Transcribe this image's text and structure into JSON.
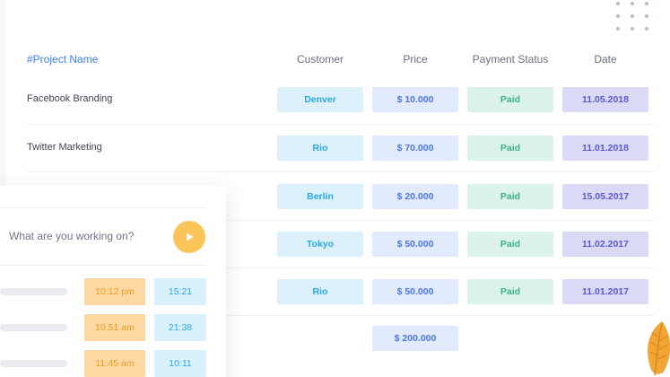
{
  "table": {
    "headers": {
      "project": "#Project Name",
      "customer": "Customer",
      "price": "Price",
      "payment_status": "Payment Status",
      "date": "Date"
    },
    "rows": [
      {
        "project": "Facebook Branding",
        "customer": "Denver",
        "price": "$ 10.000",
        "status": "Paid",
        "date": "11.05.2018"
      },
      {
        "project": "Twitter Marketing",
        "customer": "Rio",
        "price": "$ 70.000",
        "status": "Paid",
        "date": "11.01.2018"
      },
      {
        "project": "",
        "customer": "Berlin",
        "price": "$ 20.000",
        "status": "Paid",
        "date": "15.05.2017"
      },
      {
        "project": "",
        "customer": "Tokyo",
        "price": "$ 50.000",
        "status": "Paid",
        "date": "11.02.2017"
      },
      {
        "project": "",
        "customer": "Rio",
        "price": "$ 50.000",
        "status": "Paid",
        "date": "11.01.2017"
      }
    ],
    "total_price": "$ 200.000"
  },
  "timer": {
    "placeholder": "What are you working on?",
    "entries": [
      {
        "start": "10:12 pm",
        "duration": "15:21"
      },
      {
        "start": "10.51 am",
        "duration": "21:38"
      },
      {
        "start": "11:45 am",
        "duration": "10:11"
      }
    ]
  },
  "colors": {
    "accent_blue": "#3b7ff5",
    "customer_bg": "#ddf1fc",
    "price_bg": "#e2eafd",
    "status_bg": "#dcf3e9",
    "date_bg": "#dadaf6",
    "start_bg": "#fcd9a2",
    "play_button": "#fcc55a",
    "leaf": "#f0a535"
  },
  "icons": {
    "play": "play-icon",
    "decoration": "leaf-icon",
    "dots": "dot-grid-icon"
  }
}
